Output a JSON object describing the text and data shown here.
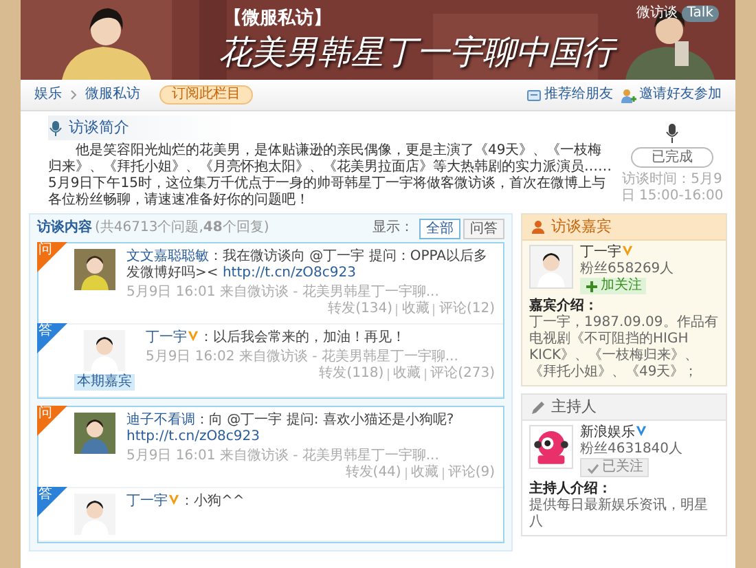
{
  "banner": {
    "tag": "【微服私访】",
    "title": "花美男韩星丁一宇聊中国行",
    "brand": "微访谈",
    "brand_badge": "Talk"
  },
  "breadcrumb": [
    {
      "label": "娱乐"
    },
    {
      "label": "微服私访"
    }
  ],
  "subscribe_button": "订阅此栏目",
  "nav_actions": [
    {
      "kind": "recommend",
      "label": "推荐给朋友"
    },
    {
      "kind": "invite",
      "label": "邀请好友参加"
    }
  ],
  "intro": {
    "heading": "访谈简介",
    "text": "他是笑容阳光灿烂的花美男，是体贴谦逊的亲民偶像，更是主演了《49天》、《一枝梅归来》、《拜托小姐》、《月亮怀抱太阳》、《花美男拉面店》等大热韩剧的实力派演员……5月9日下午15时，这位集万千优点于一身的帅哥韩星丁一宇将做客微访谈，首次在微博上与各位粉丝畅聊，请速速准备好你的问题吧！",
    "status": "已完成",
    "time": "访谈时间：5月9日 15:00-16:00"
  },
  "content": {
    "heading": "访谈内容",
    "summary": "(共46713个问题,**48**个回复)",
    "filter_label": "显示：",
    "filters": [
      {
        "label": "全部",
        "selected": true
      },
      {
        "label": "问答",
        "selected": false
      }
    ],
    "threads": [
      {
        "items": [
          {
            "kind": "question",
            "corner": "问",
            "author": "文文嘉聪聪敏",
            "text": "：我在微访谈向 @丁一宇 提问：OPPA以后多发微博好吗><",
            "link": "http://t.cn/zO8c923",
            "time": "5月9日 16:01",
            "source": "来自微访谈 - 花美男韩星丁一宇聊...",
            "actions": [
              "转发(134)",
              "收藏",
              "评论(12)"
            ]
          },
          {
            "kind": "answer",
            "corner": "答",
            "author": "丁一宇",
            "verified_badge": {
              "color": "#f39c12"
            },
            "text": "：以后我会常来的，加油！再见！",
            "tag": "本期嘉宾",
            "time": "5月9日 16:02",
            "source": "来自微访谈 - 花美男韩星丁一宇聊...",
            "actions": [
              "转发(118)",
              "收藏",
              "评论(273)"
            ]
          }
        ]
      },
      {
        "items": [
          {
            "kind": "question",
            "corner": "问",
            "author": "迪子不看调",
            "text": "：向 @丁一宇 提问: 喜欢小猫还是小狗呢?",
            "link": "http://t.cn/zO8c923",
            "time": "5月9日 16:01",
            "source": "来自微访谈 - 花美男韩星丁一宇聊...",
            "actions": [
              "转发(44)",
              "收藏",
              "评论(9)"
            ]
          },
          {
            "kind": "answer",
            "corner": "答",
            "author": "丁一宇",
            "verified_badge": {
              "color": "#f39c12"
            },
            "text": "：小狗^^"
          }
        ]
      }
    ]
  },
  "guest": {
    "heading": "访谈嘉宾",
    "name": "丁一宇",
    "verified_badge": {
      "color": "#f39c12"
    },
    "fans": "粉丝658269人",
    "follow": {
      "label": "加关注",
      "followed": false
    },
    "intro_label": "嘉宾介绍：",
    "intro": "丁一宇，1987.09.09。作品有电视剧《不可阻挡的HIGH KICK》、《一枝梅归来》、《拜托小姐》、《49天》；"
  },
  "host": {
    "heading": "主持人",
    "name": "新浪娱乐",
    "verified_badge": {
      "color": "#2b8be0"
    },
    "fans": "粉丝4631840人",
    "follow": {
      "label": "已关注",
      "followed": true
    },
    "intro_label": "主持人介绍：",
    "intro": "提供每日最新娱乐资讯，明星八"
  }
}
